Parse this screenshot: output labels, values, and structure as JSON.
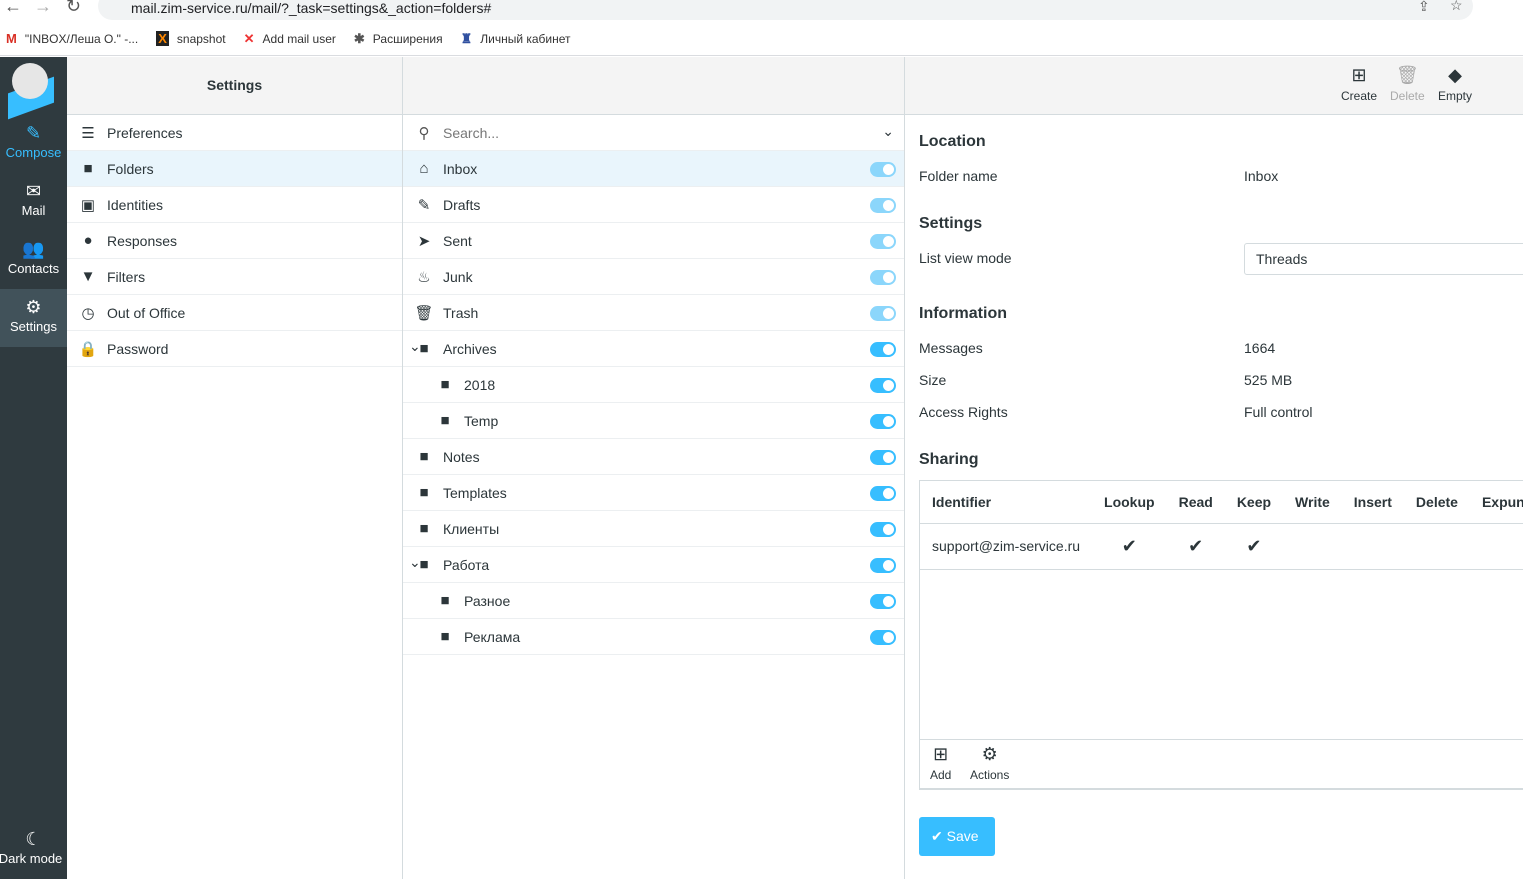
{
  "browser": {
    "url": "mail.zim-service.ru/mail/?_task=settings&_action=folders#",
    "bookmarks": [
      "\"INBOX/Леша О.\" -...",
      "snapshot",
      "Add mail user",
      "Расширения",
      "Личный кабинет"
    ]
  },
  "nav": {
    "compose": "Compose",
    "mail": "Mail",
    "contacts": "Contacts",
    "settings": "Settings",
    "dark_mode": "Dark mode"
  },
  "settings": {
    "title": "Settings",
    "items": [
      {
        "label": "Preferences",
        "icon": "sliders-icon"
      },
      {
        "label": "Folders",
        "icon": "folder-icon"
      },
      {
        "label": "Identities",
        "icon": "id-card-icon"
      },
      {
        "label": "Responses",
        "icon": "comment-icon"
      },
      {
        "label": "Filters",
        "icon": "filter-icon"
      },
      {
        "label": "Out of Office",
        "icon": "clock-icon"
      },
      {
        "label": "Password",
        "icon": "lock-icon"
      }
    ]
  },
  "folders": {
    "search_placeholder": "Search...",
    "items": [
      {
        "label": "Inbox",
        "subscribed": true,
        "protected": true
      },
      {
        "label": "Drafts",
        "subscribed": true,
        "protected": true
      },
      {
        "label": "Sent",
        "subscribed": true,
        "protected": true
      },
      {
        "label": "Junk",
        "subscribed": true,
        "protected": true
      },
      {
        "label": "Trash",
        "subscribed": true,
        "protected": true
      },
      {
        "label": "Archives",
        "subscribed": true,
        "expanded": true
      },
      {
        "label": "2018",
        "subscribed": true
      },
      {
        "label": "Temp",
        "subscribed": true
      },
      {
        "label": "Notes",
        "subscribed": true
      },
      {
        "label": "Templates",
        "subscribed": true
      },
      {
        "label": "Клиенты",
        "subscribed": true
      },
      {
        "label": "Работа",
        "subscribed": true,
        "expanded": true
      },
      {
        "label": "Разное",
        "subscribed": true
      },
      {
        "label": "Реклама",
        "subscribed": true
      }
    ]
  },
  "toolbar": {
    "create": "Create",
    "delete": "Delete",
    "empty": "Empty"
  },
  "details": {
    "location": "Location",
    "folder_name_label": "Folder name",
    "folder_name": "Inbox",
    "settings": "Settings",
    "list_view_mode_label": "List view mode",
    "list_view_mode": "Threads",
    "information": "Information",
    "messages_label": "Messages",
    "messages": "1664",
    "size_label": "Size",
    "size": "525 MB",
    "rights_label": "Access Rights",
    "rights": "Full control",
    "sharing": "Sharing",
    "columns": [
      "Identifier",
      "Lookup",
      "Read",
      "Keep",
      "Write",
      "Insert",
      "Delete",
      "Expunge"
    ],
    "rows": [
      {
        "identifier": "support@zim-service.ru",
        "check": "✔"
      }
    ],
    "add": "Add",
    "actions": "Actions",
    "save": "Save"
  }
}
